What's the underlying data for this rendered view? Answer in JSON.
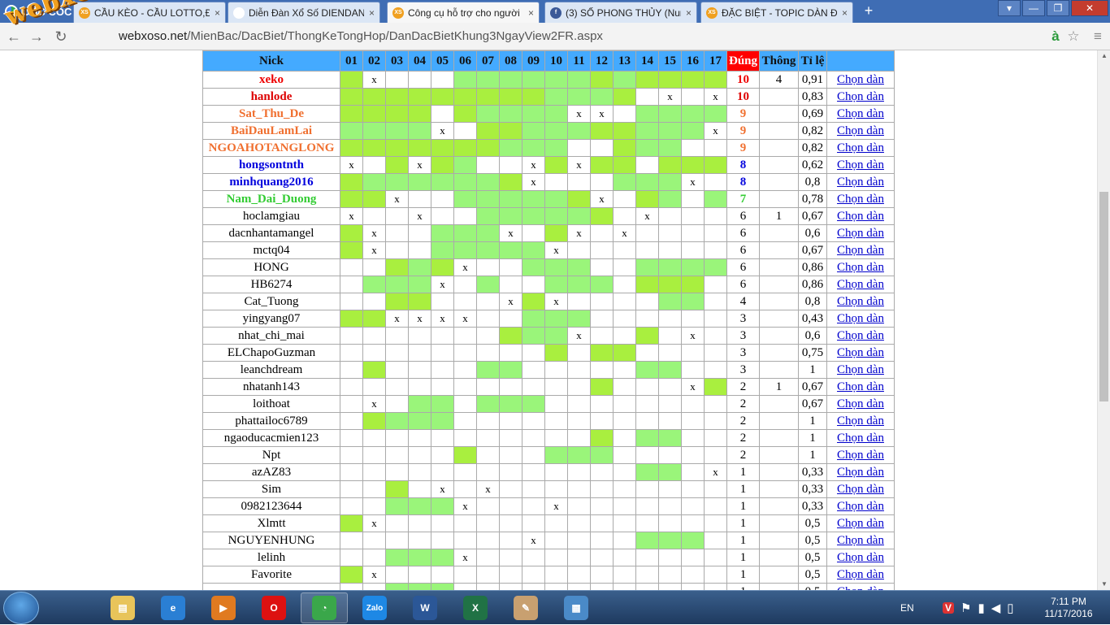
{
  "browser": {
    "brand": "CỐC CỐC",
    "tabs": [
      {
        "title": "CẦU KÈO - CẦU LOTTO,ĐẦ",
        "fav": "XS",
        "fav_color": "#f0a020",
        "active": false
      },
      {
        "title": "Diễn Đàn Xổ Số DIENDAN",
        "fav": "",
        "fav_color": "#ffffff",
        "active": false
      },
      {
        "title": "Công cụ hỗ trợ cho người",
        "fav": "XS",
        "fav_color": "#f0a020",
        "active": true
      },
      {
        "title": "(3) SỐ PHONG THỦY (Num",
        "fav": "f",
        "fav_color": "#3b5998",
        "active": false
      },
      {
        "title": "ĐẶC BIỆT - TOPIC DÀN ĐẶ",
        "fav": "XS",
        "fav_color": "#f0a020",
        "active": false
      }
    ],
    "url_host": "webxoso.net",
    "url_path": "/MienBac/DacBiet/ThongKeTongHop/DanDacBietKhung3NgayView2FR.aspx",
    "watermark": "webxoso.net"
  },
  "table": {
    "headers": {
      "nick": "Nick",
      "days": [
        "01",
        "02",
        "03",
        "04",
        "05",
        "06",
        "07",
        "08",
        "09",
        "10",
        "11",
        "12",
        "13",
        "14",
        "15",
        "16",
        "17"
      ],
      "dung": "Đúng",
      "thong": "Thông",
      "tile": "Tỉ lệ",
      "chon": ""
    },
    "link_label": "Chọn dàn",
    "rows": [
      {
        "nick": "xeko",
        "color": "#ee0000",
        "bold": true,
        "cells": "1x000222222121111",
        "dung": "10",
        "thong": "4",
        "tile": "0,91"
      },
      {
        "nick": "hanlode",
        "color": "#dd0000",
        "bold": true,
        "cells": "11111111122210x0x",
        "dung": "10",
        "thong": "",
        "tile": "0,83"
      },
      {
        "nick": "Sat_Thu_De",
        "color": "#f07030",
        "bold": true,
        "cells": "1111012222xx02222",
        "dung": "9",
        "thong": "",
        "tile": "0,69"
      },
      {
        "nick": "BaiDauLamLai",
        "color": "#f07030",
        "bold": true,
        "cells": "2222x01122211222x",
        "dung": "9",
        "thong": "",
        "tile": "0,82"
      },
      {
        "nick": "NGOAHOTANGLONG",
        "color": "#f07030",
        "bold": true,
        "cells": "11111112220012200x",
        "dung": "9",
        "thong": "",
        "tile": "0,82"
      },
      {
        "nick": "hongsontnth",
        "color": "#0000dd",
        "bold": true,
        "cells": "x01x1200x1x110111x",
        "dung": "8",
        "thong": "",
        "tile": "0,62"
      },
      {
        "nick": "minhquang2016",
        "color": "#0000dd",
        "bold": true,
        "cells": "12222221x000222x",
        "dung": "8",
        "thong": "",
        "tile": "0,8"
      },
      {
        "nick": "Nam_Dai_Duong",
        "color": "#33cc33",
        "bold": true,
        "cells": "11x00222221x01202",
        "dung": "7",
        "thong": "",
        "tile": "0,78"
      },
      {
        "nick": "hoclamgiau",
        "color": "#000",
        "bold": false,
        "cells": "x00x002222210x0001",
        "dung": "6",
        "thong": "1",
        "tile": "0,67"
      },
      {
        "nick": "dacnhantamangel",
        "color": "#000",
        "bold": false,
        "cells": "1x00222x01x0x0",
        "dung": "6",
        "thong": "",
        "tile": "0,6"
      },
      {
        "nick": "mctq04",
        "color": "#000",
        "bold": false,
        "cells": "1x0022222x000000",
        "dung": "6",
        "thong": "",
        "tile": "0,67"
      },
      {
        "nick": "HONG",
        "color": "#000",
        "bold": false,
        "cells": "00121x00222002222",
        "dung": "6",
        "thong": "",
        "tile": "0,86"
      },
      {
        "nick": "HB6274",
        "color": "#000",
        "bold": false,
        "cells": "0222x02002220111",
        "dung": "6",
        "thong": "",
        "tile": "0,86"
      },
      {
        "nick": "Cat_Tuong",
        "color": "#000",
        "bold": false,
        "cells": "0011000x1x000022",
        "dung": "4",
        "thong": "",
        "tile": "0,8"
      },
      {
        "nick": "yingyang07",
        "color": "#000",
        "bold": false,
        "cells": "11xxxx00222000000",
        "dung": "3",
        "thong": "",
        "tile": "0,43"
      },
      {
        "nick": "nhat_chi_mai",
        "color": "#000",
        "bold": false,
        "cells": "0000000122x0010x0",
        "dung": "3",
        "thong": "",
        "tile": "0,6"
      },
      {
        "nick": "ELChapoGuzman",
        "color": "#000",
        "bold": false,
        "cells": "00000000010110000x",
        "dung": "3",
        "thong": "",
        "tile": "0,75"
      },
      {
        "nick": "leanchdream",
        "color": "#000",
        "bold": false,
        "cells": "01000022000002200",
        "dung": "3",
        "thong": "",
        "tile": "1"
      },
      {
        "nick": "nhatanh143",
        "color": "#000",
        "bold": false,
        "cells": "000000000001000x1",
        "dung": "2",
        "thong": "1",
        "tile": "0,67"
      },
      {
        "nick": "loithoat",
        "color": "#000",
        "bold": false,
        "cells": "0x0220222000000000",
        "dung": "2",
        "thong": "",
        "tile": "0,67"
      },
      {
        "nick": "phattailoc6789",
        "color": "#000",
        "bold": false,
        "cells": "01222000000000000",
        "dung": "2",
        "thong": "",
        "tile": "1"
      },
      {
        "nick": "ngaoducacmien123",
        "color": "#000",
        "bold": false,
        "cells": "00000000000102200",
        "dung": "2",
        "thong": "",
        "tile": "1"
      },
      {
        "nick": "Npt",
        "color": "#000",
        "bold": false,
        "cells": "00000100022200000",
        "dung": "2",
        "thong": "",
        "tile": "1"
      },
      {
        "nick": "azAZ83",
        "color": "#000",
        "bold": false,
        "cells": "0000000000000220x",
        "dung": "1",
        "thong": "",
        "tile": "0,33"
      },
      {
        "nick": "Sim",
        "color": "#000",
        "bold": false,
        "cells": "0010x0x0000000000",
        "dung": "1",
        "thong": "",
        "tile": "0,33"
      },
      {
        "nick": "0982123644",
        "color": "#000",
        "bold": false,
        "cells": "00222x000x0000000",
        "dung": "1",
        "thong": "",
        "tile": "0,33"
      },
      {
        "nick": "Xlmtt",
        "color": "#000",
        "bold": false,
        "cells": "1x000000000000000",
        "dung": "1",
        "thong": "",
        "tile": "0,5"
      },
      {
        "nick": "NGUYENHUNG",
        "color": "#000",
        "bold": false,
        "cells": "00000000x0000222000",
        "dung": "1",
        "thong": "",
        "tile": "0,5"
      },
      {
        "nick": "lelinh",
        "color": "#000",
        "bold": false,
        "cells": "00222x00000000000",
        "dung": "1",
        "thong": "",
        "tile": "0,5"
      },
      {
        "nick": "Favorite",
        "color": "#000",
        "bold": false,
        "cells": "1x000000000000000",
        "dung": "1",
        "thong": "",
        "tile": "0,5"
      },
      {
        "nick": "",
        "color": "#000",
        "bold": false,
        "cells": "00222x00000000000",
        "dung": "1",
        "thong": "",
        "tile": "0,5"
      }
    ]
  },
  "taskbar": {
    "apps": [
      "explorer",
      "ie",
      "media",
      "opera",
      "coccoc",
      "zalo",
      "word",
      "excel",
      "paint",
      "photo"
    ],
    "lang": "EN",
    "time": "7:11 PM",
    "date": "11/17/2016"
  }
}
